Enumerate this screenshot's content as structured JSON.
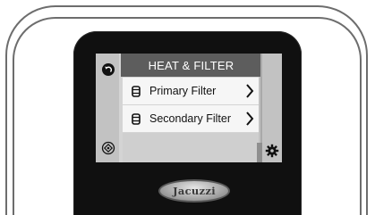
{
  "screen": {
    "title": "HEAT & FILTER",
    "items": [
      {
        "label": "Primary Filter",
        "icon": "filter-cartridge-icon"
      },
      {
        "label": "Secondary Filter",
        "icon": "filter-cartridge-icon"
      }
    ]
  },
  "brand": {
    "logo_text": "Jacuzzi"
  },
  "colors": {
    "title_bar": "#5d5d5d",
    "row_background": "#f6f6f6",
    "screen_background": "#c9c9c9",
    "panel": "#101010"
  }
}
